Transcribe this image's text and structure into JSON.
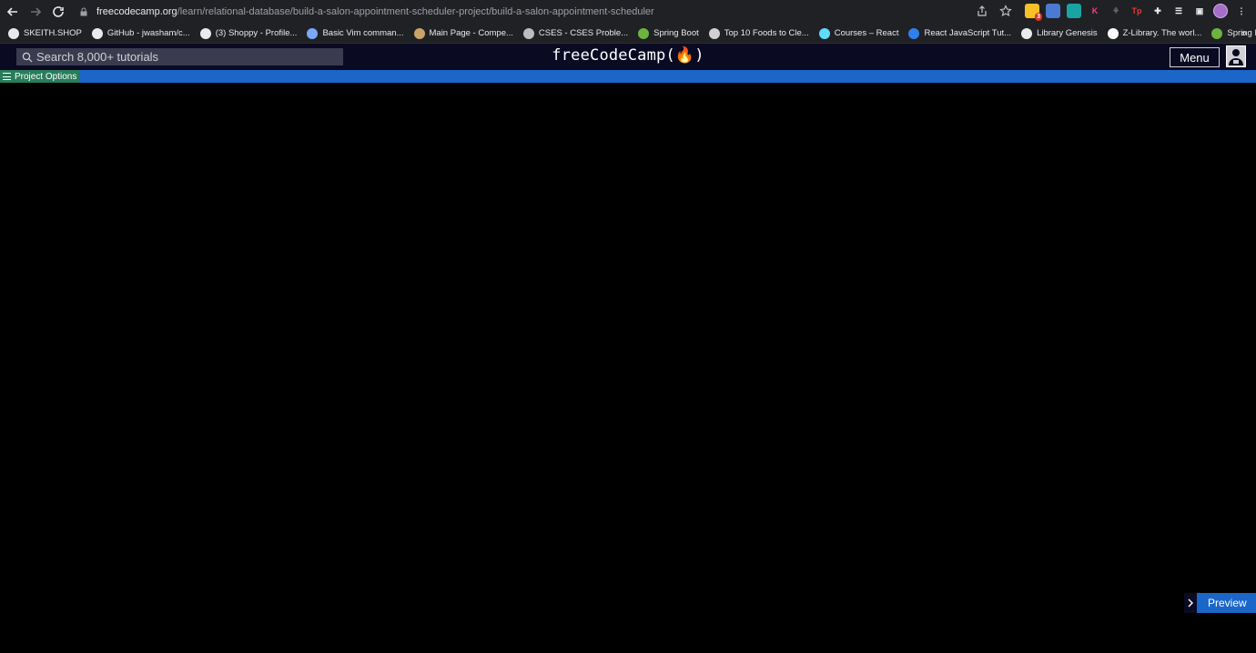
{
  "browser": {
    "url_host": "freecodecamp.org",
    "url_path": "/learn/relational-database/build-a-salon-appointment-scheduler-project/build-a-salon-appointment-scheduler",
    "extension_badge": "3"
  },
  "bookmarks": [
    {
      "label": "SKEITH.SHOP",
      "icon": "tag-icon",
      "color": "#e8eaed"
    },
    {
      "label": "GitHub - jwasham/c...",
      "icon": "github-icon",
      "color": "#e8eaed"
    },
    {
      "label": "(3) Shoppy - Profile...",
      "icon": "shoppy-icon",
      "color": "#e8eaed"
    },
    {
      "label": "Basic Vim comman...",
      "icon": "dots-icon",
      "color": "#7aa7ff"
    },
    {
      "label": "Main Page - Compe...",
      "icon": "wiki-icon",
      "color": "#c9a46a"
    },
    {
      "label": "CSES - CSES Proble...",
      "icon": "cses-icon",
      "color": "#bdbdbd"
    },
    {
      "label": "Spring Boot",
      "icon": "spring-icon",
      "color": "#6db33f"
    },
    {
      "label": "Top 10 Foods to Cle...",
      "icon": "tooth-icon",
      "color": "#d0d0d0"
    },
    {
      "label": "Courses – React",
      "icon": "react-icon",
      "color": "#61dafb"
    },
    {
      "label": "React JavaScript Tut...",
      "icon": "vscode-icon",
      "color": "#2f80ed"
    },
    {
      "label": "Library Genesis",
      "icon": "book-icon",
      "color": "#e8eaed"
    },
    {
      "label": "Z-Library. The worl...",
      "icon": "zlib-icon",
      "color": "#ffffff"
    },
    {
      "label": "Spring Framework...",
      "icon": "spring-icon",
      "color": "#6db33f"
    }
  ],
  "fcc": {
    "search_placeholder": "Search 8,000+ tutorials",
    "brand": "freeCodeCamp(🔥)",
    "menu_label": "Menu"
  },
  "project_options": {
    "label": "Project Options"
  },
  "preview": {
    "label": "Preview"
  },
  "colors": {
    "nav_bg": "#0a0a23",
    "options_bar": "#1b66c9",
    "options_btn": "#2a7c5b",
    "page_bg": "#000000"
  }
}
